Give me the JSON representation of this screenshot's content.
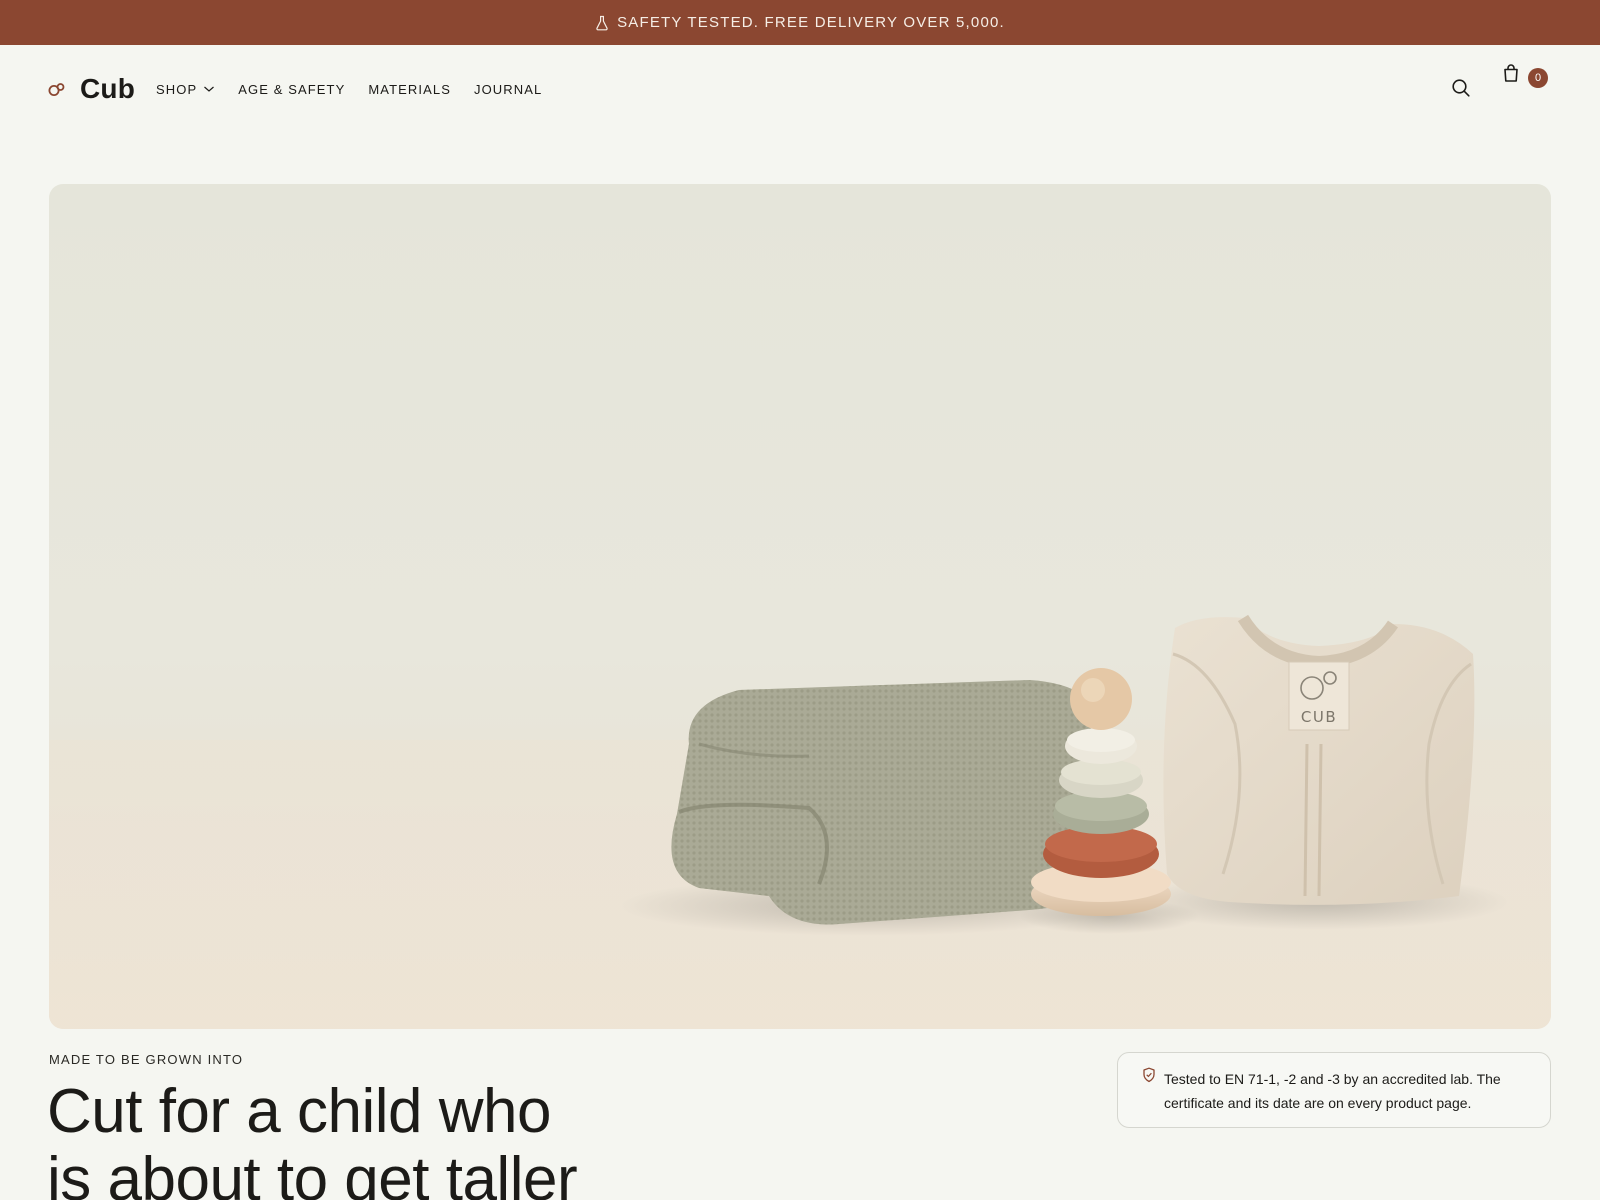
{
  "announcement": {
    "icon": "flask-icon",
    "text": "SAFETY TESTED. FREE DELIVERY OVER 5,000."
  },
  "header": {
    "logo_text": "Cub",
    "nav": [
      {
        "label": "SHOP",
        "has_dropdown": true
      },
      {
        "label": "AGE & SAFETY"
      },
      {
        "label": "MATERIALS"
      },
      {
        "label": "JOURNAL"
      }
    ],
    "cart_count": "0"
  },
  "hero": {
    "garment_tag": "CUB"
  },
  "intro": {
    "eyebrow": "MADE TO BE GROWN INTO",
    "headline_line1": "Cut for a child who",
    "headline_line2": "is about to get taller"
  },
  "safety_notice": {
    "icon": "shield-icon",
    "text": "Tested to EN 71-1, -2 and -3 by an accredited lab. The certificate and its date are on every product page."
  },
  "colors": {
    "accent": "#8b4731",
    "background": "#f5f6f1",
    "text": "#1c1b18"
  }
}
